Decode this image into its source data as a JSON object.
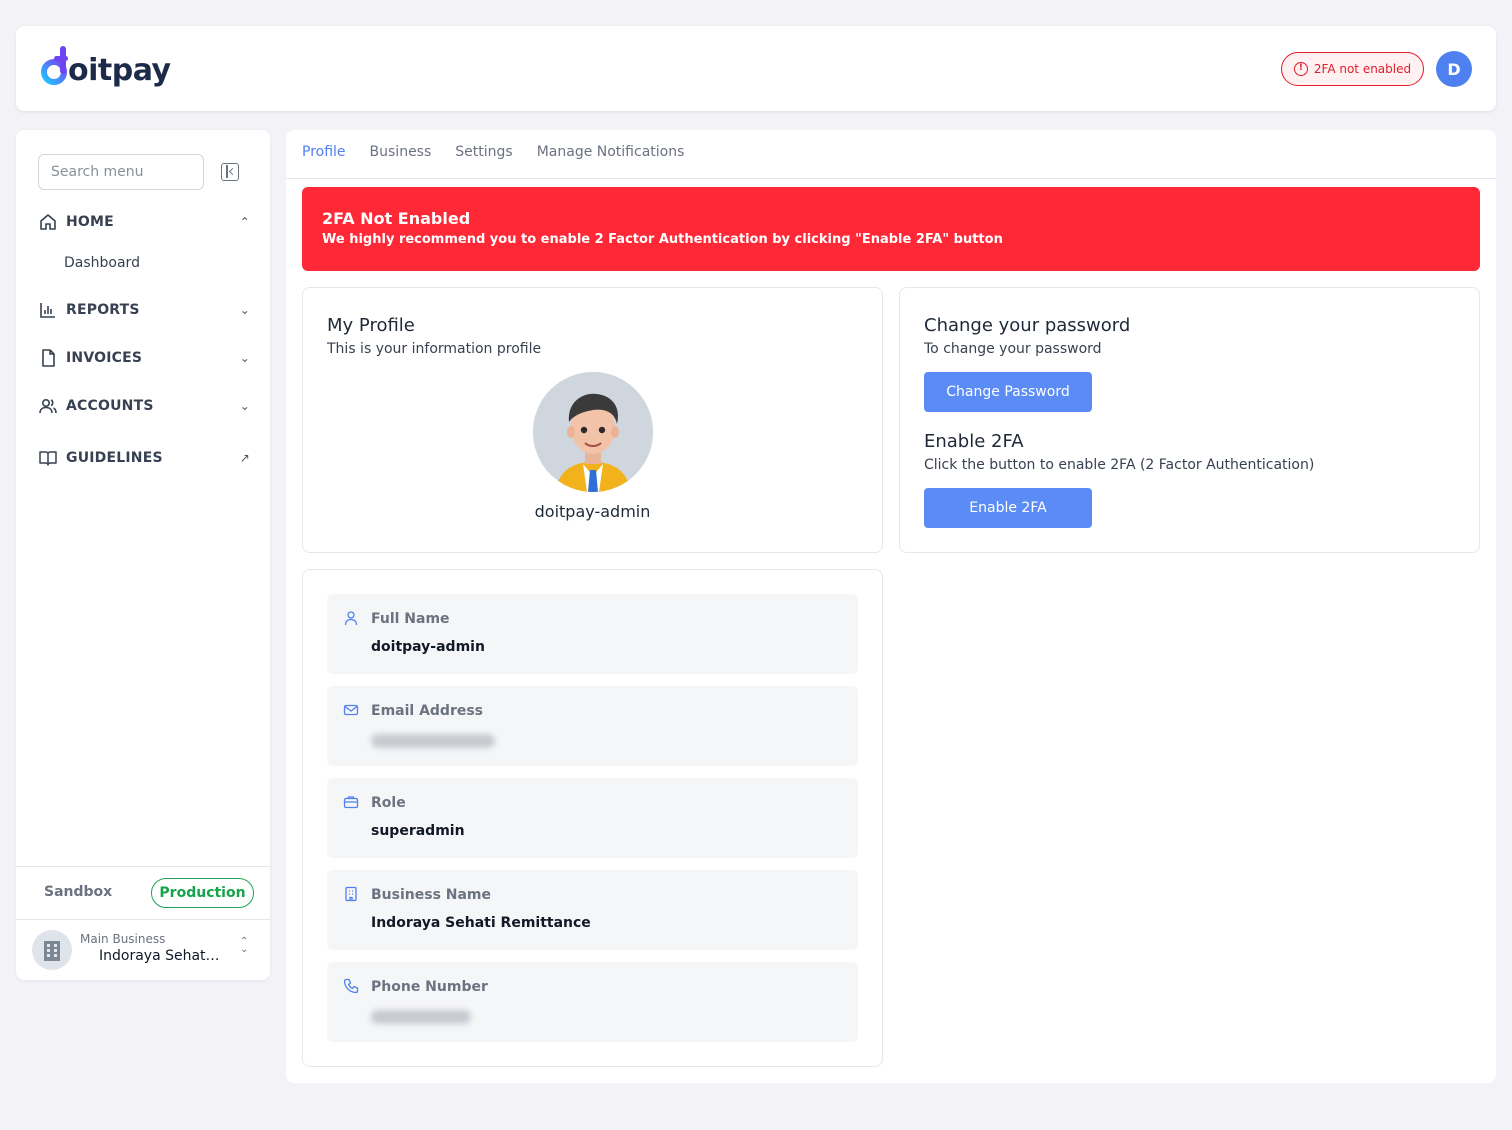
{
  "brand": {
    "logo_text": "oitpay"
  },
  "header": {
    "twofa_badge": "2FA not enabled",
    "avatar_initial": "D"
  },
  "sidebar": {
    "search_placeholder": "Search menu",
    "items": [
      {
        "label": "HOME",
        "icon": "home-icon",
        "expanded": true
      },
      {
        "label": "REPORTS",
        "icon": "bar-chart-icon"
      },
      {
        "label": "INVOICES",
        "icon": "file-icon"
      },
      {
        "label": "ACCOUNTS",
        "icon": "users-icon"
      },
      {
        "label": "GUIDELINES",
        "icon": "book-icon",
        "external": true
      }
    ],
    "sub_items": [
      "Dashboard"
    ],
    "env": {
      "sandbox": "Sandbox",
      "production": "Production",
      "active": "Production"
    },
    "business": {
      "label": "Main Business",
      "name": "Indoraya Sehati Remittance"
    }
  },
  "tabs": [
    {
      "label": "Profile",
      "active": true
    },
    {
      "label": "Business"
    },
    {
      "label": "Settings"
    },
    {
      "label": "Manage Notifications"
    }
  ],
  "alert": {
    "title": "2FA Not Enabled",
    "text": "We highly recommend you to enable 2 Factor Authentication by clicking \"Enable 2FA\" button"
  },
  "profile": {
    "title": "My Profile",
    "subtitle": "This is your information profile",
    "username": "doitpay-admin"
  },
  "password": {
    "title": "Change your password",
    "subtitle": "To change your password",
    "button": "Change Password",
    "twofa_title": "Enable 2FA",
    "twofa_subtitle": "Click the button to enable 2FA (2 Factor Authentication)",
    "twofa_button": "Enable 2FA"
  },
  "info": [
    {
      "label": "Full Name",
      "value": "doitpay-admin",
      "icon": "user-icon"
    },
    {
      "label": "Email Address",
      "value": "",
      "icon": "mail-icon",
      "blurred": true
    },
    {
      "label": "Role",
      "value": "superadmin",
      "icon": "briefcase-icon"
    },
    {
      "label": "Business Name",
      "value": "Indoraya Sehati Remittance",
      "icon": "building-icon"
    },
    {
      "label": "Phone Number",
      "value": "",
      "icon": "phone-icon",
      "blurred": true
    }
  ],
  "colors": {
    "accent": "#4f80f0",
    "danger": "#ff2837",
    "success": "#16a34a",
    "button": "#5b8cf5"
  }
}
